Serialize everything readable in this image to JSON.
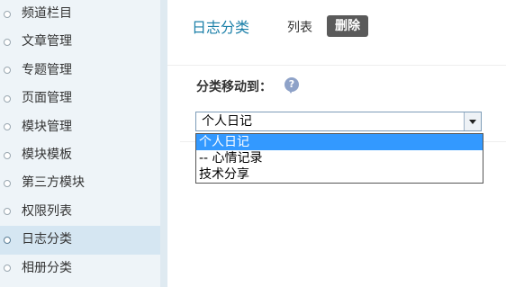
{
  "sidebar": {
    "items": [
      {
        "label": "频道栏目"
      },
      {
        "label": "文章管理"
      },
      {
        "label": "专题管理"
      },
      {
        "label": "页面管理"
      },
      {
        "label": "模块管理"
      },
      {
        "label": "模块模板"
      },
      {
        "label": "第三方模块"
      },
      {
        "label": "权限列表"
      },
      {
        "label": "日志分类"
      },
      {
        "label": "相册分类"
      }
    ],
    "active_index": 8
  },
  "header": {
    "title": "日志分类",
    "tab_list": "列表",
    "tab_delete": "删除"
  },
  "form": {
    "move_label": "分类移动到：",
    "help_icon": "question-icon",
    "select_value": "个人日记",
    "options": [
      "个人日记",
      "-- 心情记录",
      "技术分享"
    ],
    "selected_option_index": 0
  },
  "colors": {
    "accent": "#1a7fa8",
    "sidebar_bg": "#eef4f8",
    "selected_option_bg": "#3399ff",
    "delete_button_bg": "#5a5a5a"
  }
}
